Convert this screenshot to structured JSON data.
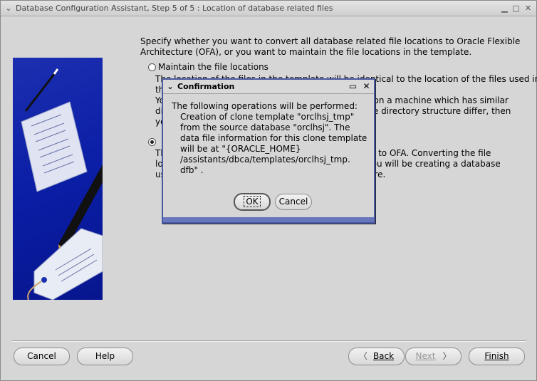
{
  "window": {
    "title": "Database Configuration Assistant, Step 5 of 5 : Location of database related files"
  },
  "content": {
    "intro": "Specify whether you want to convert all database related file locations to Oracle Flexible Architecture (OFA), or you want to maintain the file locations in the template.",
    "options": [
      {
        "label": "Maintain the file locations",
        "selected": false,
        "description": "The location of the files in the template will be identical to the location of the files used in the ... You ... on a machine which has similar di... f the directory structure differ, then yo..."
      },
      {
        "label": "C...",
        "selected": true,
        "description": "Th... ted to OFA. Converting the file lo... e you will be creating a database us... cture."
      }
    ],
    "maintain_desc_lines": [
      "The location of the files in the template will be identical to the location of the files used in",
      "th",
      "Yo                                                                        on on a machine which has similar",
      "di                                                                        f the directory structure differ, then",
      "yo"
    ],
    "convert_desc_lines": [
      "Th                                                                        ted to OFA. Converting the file",
      "lo                                                                        e you will be creating a database",
      "us                                                                        cture."
    ]
  },
  "buttons": {
    "cancel": "Cancel",
    "help": "Help",
    "back": "Back",
    "next": "Next",
    "finish": "Finish"
  },
  "dialog": {
    "title": "Confirmation",
    "heading": "The following operations will be performed:",
    "lines": [
      "Creation of clone template \"orclhsj_tmp\"",
      "from the source database \"orclhsj\". The",
      "data file information for this clone template",
      "will be at \"{ORACLE_HOME}",
      "/assistants/dbca/templates/orclhsj_tmp.",
      "dfb\" ."
    ],
    "ok": "OK",
    "cancel": "Cancel"
  },
  "icons": {
    "window_menu": "chevron-down-icon",
    "minimize": "minimize-icon",
    "maximize": "maximize-icon",
    "close": "close-icon",
    "back_arrow": "chevron-left-icon",
    "next_arrow": "chevron-right-icon"
  }
}
